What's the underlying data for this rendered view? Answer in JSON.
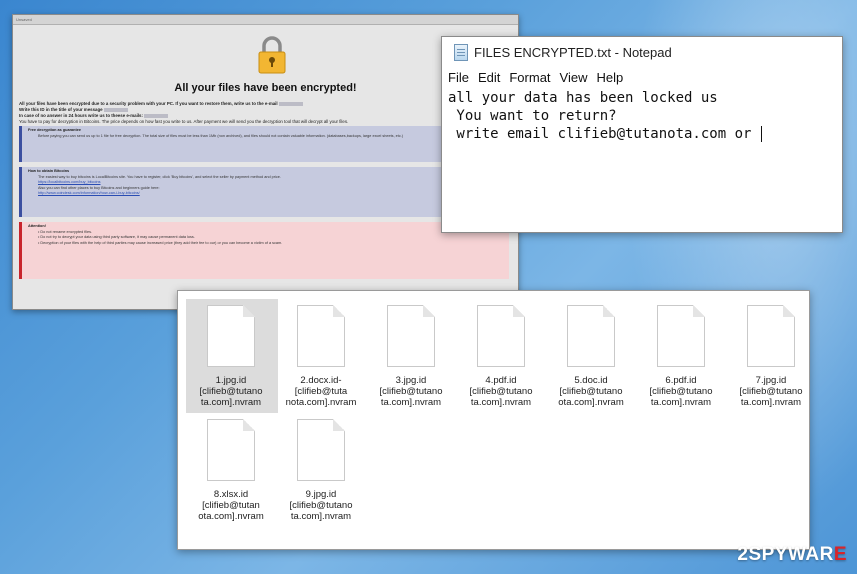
{
  "ransom_window": {
    "titlebar": "Unsaved",
    "heading": "All your files have been encrypted!",
    "line1": "All your files have been encrypted due to a security problem with your PC. If you want to restore them, write us to the e-mail",
    "line2": "Write this ID in the title of your message",
    "line3": "In case of no answer in 24 hours write us to theese e-mails:",
    "line4": "You have to pay for decryption in Bitcoins. The price depends on how fast you write to us. After payment we will send you the decryption tool that will decrypt all your files.",
    "box1_title": "Free decryption as guarantee",
    "box1_text": "Before paying you can send us up to 1 file for free decryption. The total size of files must be less than 1Mb (non archived), and files should not contain valuable information. (databases,backups, large excel sheets, etc.)",
    "box2_title": "How to obtain Bitcoins",
    "box2_text1": "The easiest way to buy bitcoins is LocalBitcoins site. You have to register, click 'Buy bitcoins', and select the seller by payment method and price.",
    "box2_link1": "https://localbitcoins.com/buy_bitcoins",
    "box2_text2": "Also you can find other places to buy Bitcoins and beginners guide here:",
    "box2_link2": "http://www.coindesk.com/information/how-can-i-buy-bitcoins/",
    "box3_title": "Attention!",
    "box3_item1": "Do not rename encrypted files.",
    "box3_item2": "Do not try to decrypt your data using third party software, it may cause permanent data loss.",
    "box3_item3": "Decryption of your files with the help of third parties may cause increased price (they add their fee to our) or you can become a victim of a scam."
  },
  "notepad": {
    "title": "FILES ENCRYPTED.txt - Notepad",
    "menu": [
      "File",
      "Edit",
      "Format",
      "View",
      "Help"
    ],
    "lines": [
      "all your data has been locked us",
      " You want to return?",
      " write email clifieb@tutanota.com or "
    ]
  },
  "explorer": {
    "files": [
      {
        "line1": "1.jpg.id",
        "line2": "[clifieb@tutano",
        "line3": "ta.com].nvram"
      },
      {
        "line1": "2.docx.id-",
        "line2": "[clifieb@tuta",
        "line3": "nota.com].nvram"
      },
      {
        "line1": "3.jpg.id",
        "line2": "[clifieb@tutano",
        "line3": "ta.com].nvram"
      },
      {
        "line1": "4.pdf.id",
        "line2": "[clifieb@tutano",
        "line3": "ta.com].nvram"
      },
      {
        "line1": "5.doc.id",
        "line2": "[clifieb@tutano",
        "line3": "ota.com].nvram"
      },
      {
        "line1": "6.pdf.id",
        "line2": "[clifieb@tutano",
        "line3": "ta.com].nvram"
      },
      {
        "line1": "7.jpg.id",
        "line2": "[clifieb@tutano",
        "line3": "ta.com].nvram"
      },
      {
        "line1": "8.xlsx.id",
        "line2": "[clifieb@tutan",
        "line3": "ota.com].nvram"
      },
      {
        "line1": "9.jpg.id",
        "line2": "[clifieb@tutano",
        "line3": "ta.com].nvram"
      }
    ]
  },
  "watermark": {
    "part1": "2",
    "part2": "SPYWAR",
    "part3": "E"
  },
  "colors": {
    "lock_gold": "#f2b632",
    "box_blue": "#c6cadf",
    "box_red": "#f6d3d5"
  }
}
